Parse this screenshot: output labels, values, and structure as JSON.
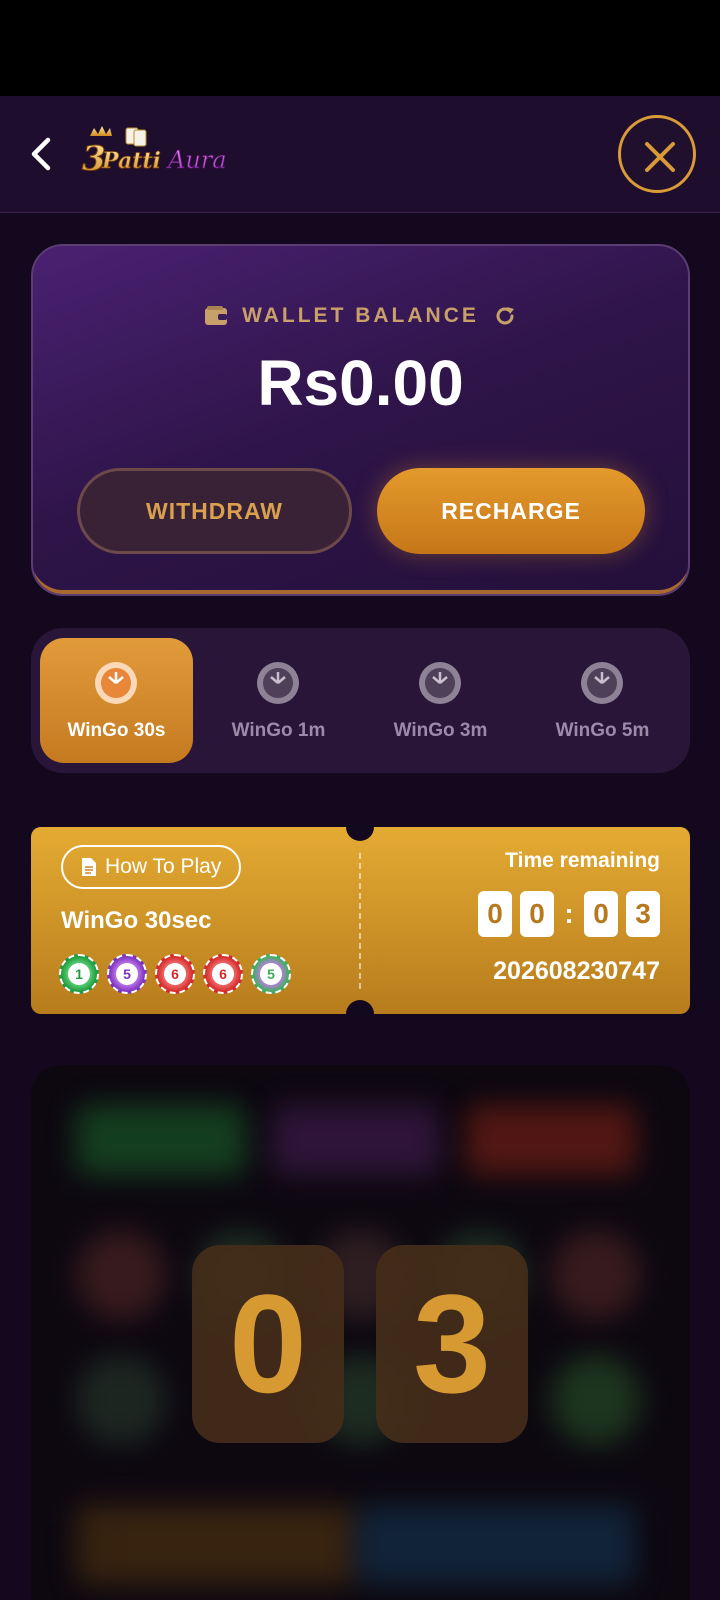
{
  "header": {
    "logo_text": "3Patti Aura"
  },
  "wallet": {
    "title": "WALLET BALANCE",
    "balance": "Rs0.00",
    "withdraw_label": "WITHDRAW",
    "recharge_label": "RECHARGE"
  },
  "tabs": [
    {
      "label": "WinGo 30s",
      "active": true
    },
    {
      "label": "WinGo 1m",
      "active": false
    },
    {
      "label": "WinGo 3m",
      "active": false
    },
    {
      "label": "WinGo 5m",
      "active": false
    }
  ],
  "ticket": {
    "how_to_play": "How To Play",
    "game_name": "WinGo 30sec",
    "recent_results": [
      "1",
      "5",
      "6",
      "6",
      "5"
    ],
    "time_label": "Time remaining",
    "timer_digits": [
      "0",
      "0",
      "0",
      "3"
    ],
    "timer_separator": ":",
    "period": "202608230747"
  },
  "countdown": {
    "digits": [
      "0",
      "3"
    ]
  },
  "colors": {
    "accent": "#e49a2c",
    "background": "#14081e",
    "card": "#2e1448"
  }
}
